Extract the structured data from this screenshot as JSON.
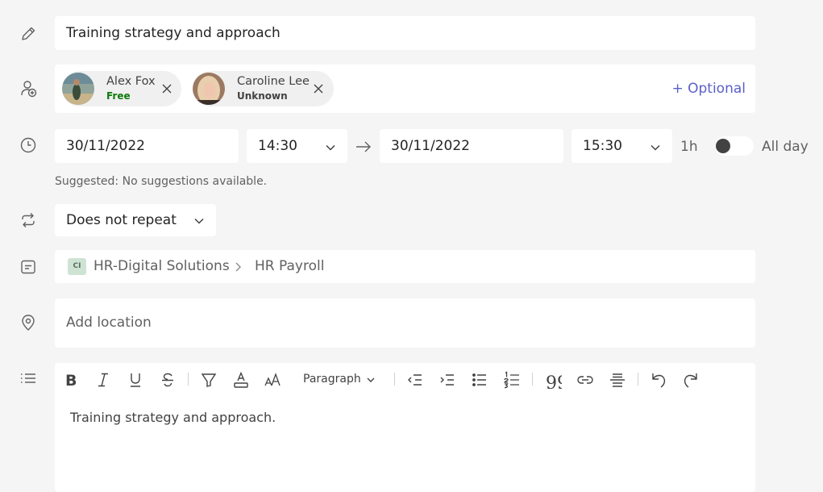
{
  "title": {
    "value": "Training strategy and approach"
  },
  "attendees": [
    {
      "name": "Alex Fox",
      "status": "Free",
      "status_color": "#0e7a0d"
    },
    {
      "name": "Caroline Lee",
      "status": "Unknown",
      "status_color": "#424242"
    }
  ],
  "optional_label": "+ Optional",
  "schedule": {
    "start_date": "30/11/2022",
    "start_time": "14:30",
    "end_date": "30/11/2022",
    "end_time": "15:30",
    "duration": "1h",
    "all_day_label": "All day",
    "all_day": false
  },
  "suggested_text": "Suggested: No suggestions available.",
  "repeat": {
    "value": "Does not repeat"
  },
  "channel": {
    "badge": "CI",
    "team": "HR-Digital Solutions",
    "channel": "HR Payroll"
  },
  "location": {
    "placeholder": "Add location"
  },
  "editor": {
    "paragraph_style": "Paragraph",
    "body": "Training strategy and approach."
  },
  "colors": {
    "accent": "#5b5fc7",
    "free": "#0e7a0d",
    "background": "#f5f5f5"
  }
}
